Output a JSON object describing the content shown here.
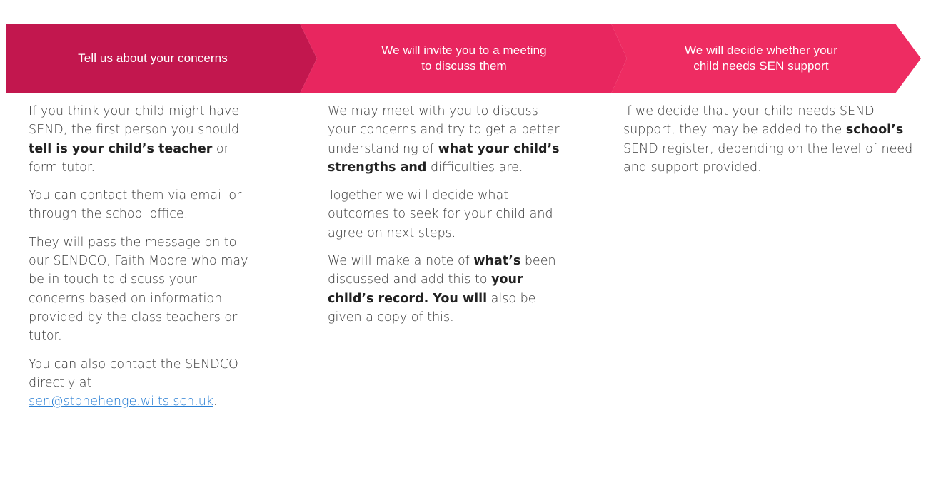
{
  "banner": {
    "colors": {
      "step1": "#c2174e",
      "step2": "#e8265f",
      "step3": "#ee2c62",
      "text": "#ffffff"
    },
    "steps": [
      {
        "label": "Tell us about your concerns"
      },
      {
        "label": "We will invite you to a meeting\nto discuss them"
      },
      {
        "label": "We will decide whether your\nchild needs SEN support"
      }
    ]
  },
  "col1": {
    "p1": {
      "a": "If you think your child might have SEND, the first person you should ",
      "b": "tell is your child’s teacher",
      "c": " or form tutor."
    },
    "p2": "You can contact them via email or through the school office.",
    "p3": "They will pass the message on to our SENDCO, Faith Moore who may be in touch to discuss your concerns based on information provided by the class teachers or tutor.",
    "p4": {
      "a": "You can also contact the SENDCO directly at ",
      "email": "sen@stonehenge.wilts.sch.uk",
      "c": "."
    }
  },
  "col2": {
    "p1": {
      "a": "We may meet with you to discuss your concerns and try to get a better understanding of ",
      "b": "what your child’s strengths and",
      "c": " difficulties are."
    },
    "p2": "Together we will decide what outcomes to seek for your child and agree on next steps.",
    "p3": {
      "a": "We will make a note of ",
      "b": "what’s",
      "c": " been discussed and add this to ",
      "d": "your child’s record. You will",
      "e": " also be given a copy of this."
    }
  },
  "col3": {
    "p1": {
      "a": "If we decide that your child needs SEND support, they may be added to the ",
      "b": "school’s",
      "c": " SEND register, depending on the level of need and support provided."
    }
  }
}
